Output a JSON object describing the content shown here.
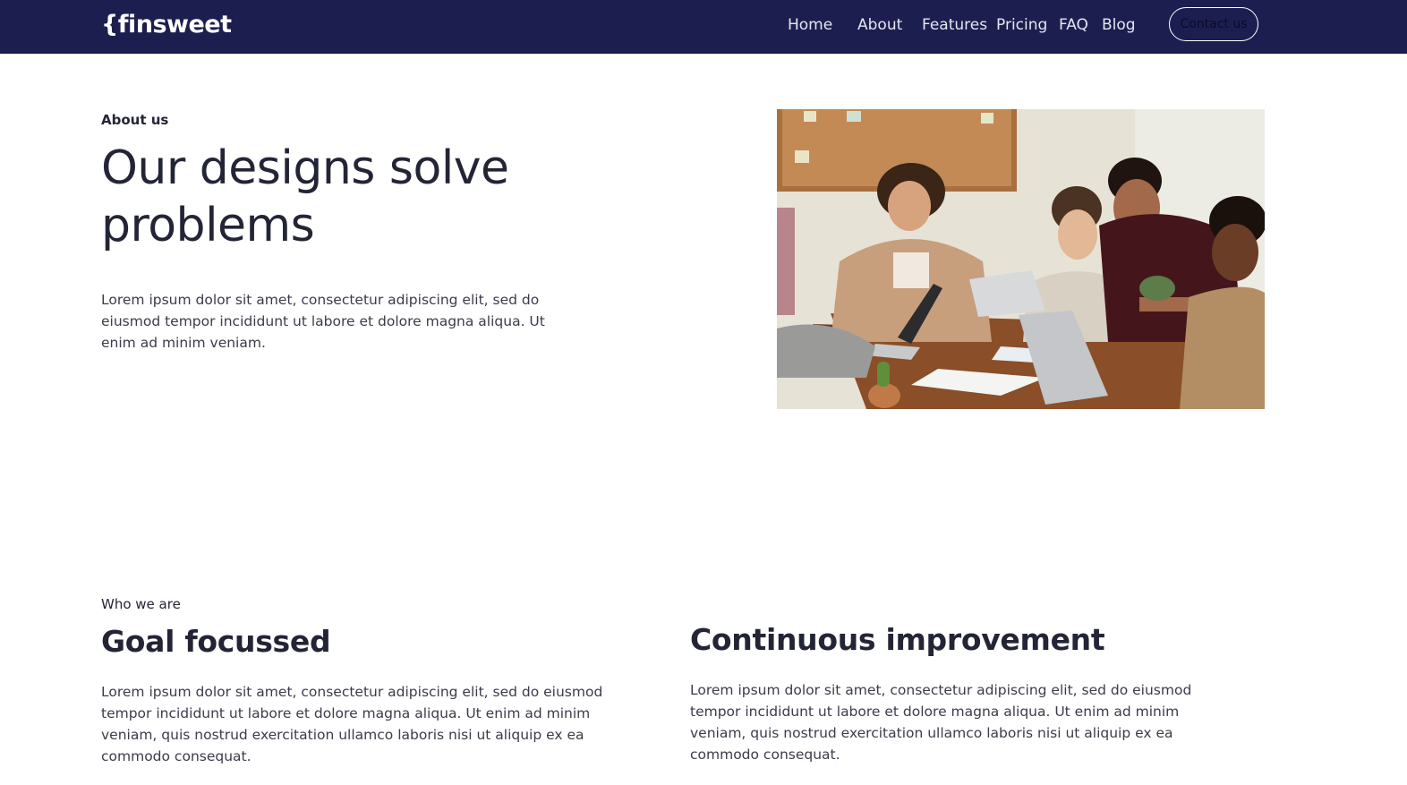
{
  "nav": {
    "logo": "{finsweet",
    "links": [
      "Home",
      "About",
      "Features",
      "Pricing",
      "FAQ",
      "Blog"
    ],
    "contact_label": "Contact us"
  },
  "hero": {
    "eyebrow": "About us",
    "title": "Our designs solve problems",
    "text": "Lorem ipsum dolor sit amet, consectetur adipiscing elit, sed do eiusmod tempor incididunt ut labore et dolore magna aliqua. Ut enim ad minim veniam."
  },
  "features": {
    "eyebrow": "Who we are",
    "items": [
      {
        "title": "Goal focussed",
        "text": "Lorem ipsum dolor sit amet, consectetur adipiscing elit, sed do eiusmod tempor incididunt ut labore et dolore magna aliqua. Ut enim ad minim veniam, quis nostrud exercitation ullamco laboris nisi ut aliquip ex ea commodo consequat."
      },
      {
        "title": "Continuous improvement",
        "text": "Lorem ipsum dolor sit amet, consectetur adipiscing elit, sed do eiusmod tempor incididunt ut labore et dolore magna aliqua. Ut enim ad minim veniam, quis nostrud exercitation ullamco laboris nisi ut aliquip ex ea commodo consequat."
      }
    ]
  },
  "colors": {
    "navbar_bg": "#1d1e50",
    "heading": "#232536",
    "body_text": "#3b3c4a"
  }
}
